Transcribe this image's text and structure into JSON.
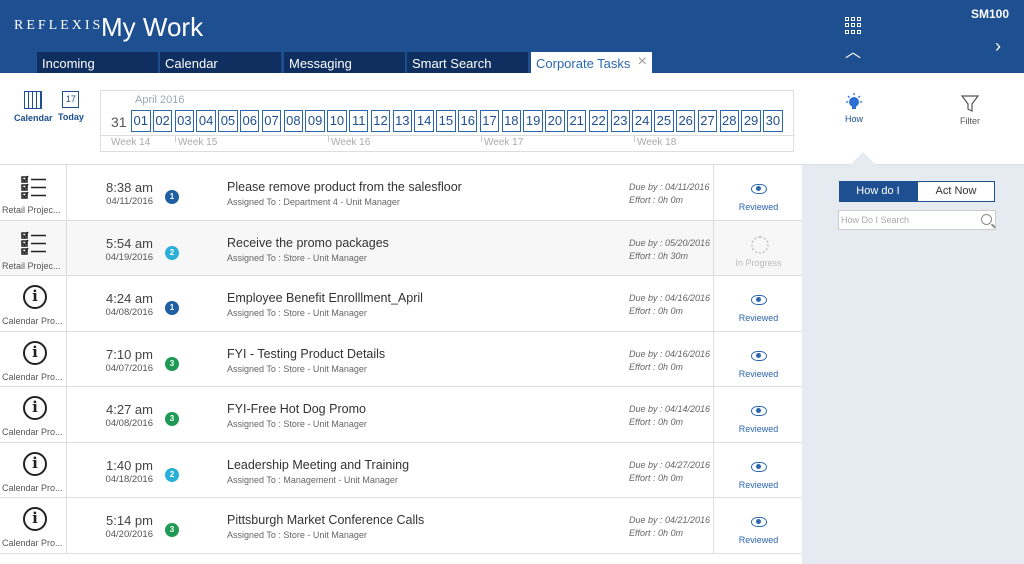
{
  "header": {
    "logo": "REFLEXIS",
    "title": "My Work",
    "user_code": "SM100"
  },
  "tabs": [
    {
      "label": "Incoming"
    },
    {
      "label": "Calendar"
    },
    {
      "label": "Messaging"
    },
    {
      "label": "Smart Search"
    },
    {
      "label": "Corporate Tasks",
      "active": true
    }
  ],
  "toolbar": {
    "calendar_label": "Calendar",
    "today_label": "Today",
    "today_icon_text": "17",
    "month_label": "April 2016",
    "first_day": "31",
    "days": [
      "01",
      "02",
      "03",
      "04",
      "05",
      "06",
      "07",
      "08",
      "09",
      "10",
      "11",
      "12",
      "13",
      "14",
      "15",
      "16",
      "17",
      "18",
      "19",
      "20",
      "21",
      "22",
      "23",
      "24",
      "25",
      "26",
      "27",
      "28",
      "29",
      "30"
    ],
    "weeks": [
      "Week 14",
      "Week 15",
      "Week 16",
      "Week 17",
      "Week 18"
    ],
    "how_label": "How",
    "filter_label": "Filter"
  },
  "right_panel": {
    "how_do_i_label": "How do I",
    "act_now_label": "Act Now",
    "search_placeholder": "How Do I Search"
  },
  "tasks": [
    {
      "type_label": "Retail Projec...",
      "icon": "checklist-icon",
      "time": "8:38 am",
      "date": "04/11/2016",
      "priority": "1",
      "title": "Please remove product from the salesfloor",
      "assigned": "Assigned To : Department 4 - Unit Manager",
      "due": "Due by : 04/11/2016",
      "effort": "Effort : 0h 0m",
      "status": "Reviewed"
    },
    {
      "type_label": "Retail Projec...",
      "icon": "checklist-icon",
      "time": "5:54 am",
      "date": "04/19/2016",
      "priority": "2",
      "title": "Receive the promo packages",
      "assigned": "Assigned To : Store - Unit Manager",
      "due": "Due by : 05/20/2016",
      "effort": "Effort : 0h 30m",
      "status": "In Progress"
    },
    {
      "type_label": "Calendar Pro...",
      "icon": "info-icon",
      "time": "4:24 am",
      "date": "04/08/2016",
      "priority": "1",
      "title": "Employee Benefit Enrolllment_April",
      "assigned": "Assigned To : Store - Unit Manager",
      "due": "Due by : 04/16/2016",
      "effort": "Effort : 0h 0m",
      "status": "Reviewed"
    },
    {
      "type_label": "Calendar Pro...",
      "icon": "info-icon",
      "time": "7:10 pm",
      "date": "04/07/2016",
      "priority": "3",
      "title": "FYI - Testing Product Details",
      "assigned": "Assigned To : Store - Unit Manager",
      "due": "Due by : 04/16/2016",
      "effort": "Effort : 0h 0m",
      "status": "Reviewed"
    },
    {
      "type_label": "Calendar Pro...",
      "icon": "info-icon",
      "time": "4:27 am",
      "date": "04/08/2016",
      "priority": "3",
      "title": "FYI-Free Hot Dog Promo",
      "assigned": "Assigned To : Store - Unit Manager",
      "due": "Due by : 04/14/2016",
      "effort": "Effort : 0h 0m",
      "status": "Reviewed"
    },
    {
      "type_label": "Calendar Pro...",
      "icon": "info-icon",
      "time": "1:40 pm",
      "date": "04/18/2016",
      "priority": "2",
      "title": "Leadership Meeting and Training",
      "assigned": "Assigned To : Management - Unit Manager",
      "due": "Due by : 04/27/2016",
      "effort": "Effort : 0h 0m",
      "status": "Reviewed"
    },
    {
      "type_label": "Calendar Pro...",
      "icon": "info-icon",
      "time": "5:14 pm",
      "date": "04/20/2016",
      "priority": "3",
      "title": "Pittsburgh Market Conference Calls",
      "assigned": "Assigned To : Store - Unit Manager",
      "due": "Due by : 04/21/2016",
      "effort": "Effort : 0h 0m",
      "status": "Reviewed"
    }
  ],
  "colors": {
    "header_bg": "#1d4f91",
    "tab_bg": "#0e2f5f",
    "priority_1": "#1d5fa0",
    "priority_2": "#2ab0d6",
    "priority_3": "#1f9a55"
  }
}
